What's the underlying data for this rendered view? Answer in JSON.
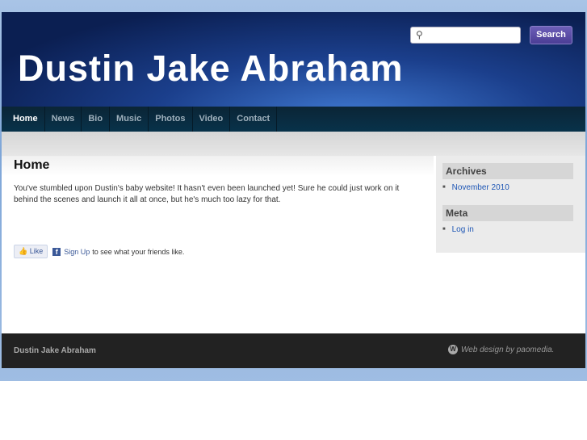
{
  "site_title": "Dustin Jake Abraham",
  "search": {
    "placeholder": "",
    "button": "Search"
  },
  "nav": [
    "Home",
    "News",
    "Bio",
    "Music",
    "Photos",
    "Video",
    "Contact"
  ],
  "main": {
    "heading": "Home",
    "body": "You've stumbled upon Dustin's baby website!  It hasn't even been launched yet!  Sure he could just work on it behind the scenes and launch it all at once, but he's much too lazy for that.",
    "like": {
      "button": "Like",
      "signup": "Sign Up",
      "text": "to see what your friends like."
    }
  },
  "sidebar": {
    "archives_title": "Archives",
    "archives": [
      "November 2010"
    ],
    "meta_title": "Meta",
    "meta": [
      "Log in"
    ]
  },
  "footer": {
    "left": "Dustin Jake Abraham",
    "right": "Web design by paomedia."
  }
}
